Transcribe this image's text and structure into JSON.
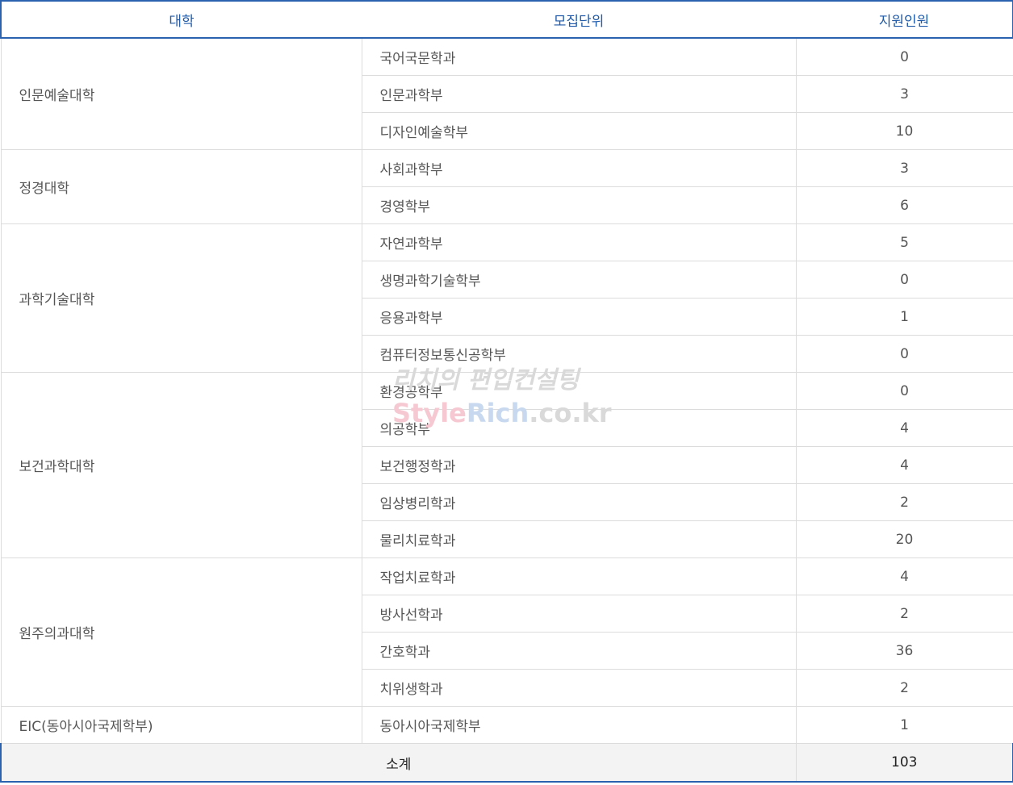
{
  "table": {
    "headers": [
      "대학",
      "모집단위",
      "지원인원"
    ],
    "colleges": [
      {
        "name": "인문예술대학",
        "units": [
          {
            "unit": "국어국문학과",
            "count": "0"
          },
          {
            "unit": "인문과학부",
            "count": "3"
          },
          {
            "unit": "디자인예술학부",
            "count": "10"
          }
        ]
      },
      {
        "name": "정경대학",
        "units": [
          {
            "unit": "사회과학부",
            "count": "3"
          },
          {
            "unit": "경영학부",
            "count": "6"
          }
        ]
      },
      {
        "name": "과학기술대학",
        "units": [
          {
            "unit": "자연과학부",
            "count": "5"
          },
          {
            "unit": "생명과학기술학부",
            "count": "0"
          },
          {
            "unit": "응용과학부",
            "count": "1"
          },
          {
            "unit": "컴퓨터정보통신공학부",
            "count": "0"
          }
        ]
      },
      {
        "name": "보건과학대학",
        "units": [
          {
            "unit": "환경공학부",
            "count": "0"
          },
          {
            "unit": "의공학부",
            "count": "4"
          },
          {
            "unit": "보건행정학과",
            "count": "4"
          },
          {
            "unit": "임상병리학과",
            "count": "2"
          },
          {
            "unit": "물리치료학과",
            "count": "20"
          }
        ]
      },
      {
        "name": "원주의과대학",
        "units": [
          {
            "unit": "작업치료학과",
            "count": "4"
          },
          {
            "unit": "방사선학과",
            "count": "2"
          },
          {
            "unit": "간호학과",
            "count": "36"
          },
          {
            "unit": "치위생학과",
            "count": "2"
          }
        ]
      },
      {
        "name": "EIC(동아시아국제학부)",
        "units": [
          {
            "unit": "동아시아국제학부",
            "count": "1"
          }
        ]
      }
    ],
    "footer": {
      "label": "소계",
      "total": "103"
    }
  },
  "watermark": {
    "line1": "리치의 편입컨설팅",
    "line2_parts": [
      "Style",
      "Rich",
      ".co.kr"
    ],
    "colors": {
      "style": "#f6c9d2",
      "rich": "#c8d9ef",
      "rest": "#d9d9d9",
      "line1": "#d9d9d9"
    }
  }
}
